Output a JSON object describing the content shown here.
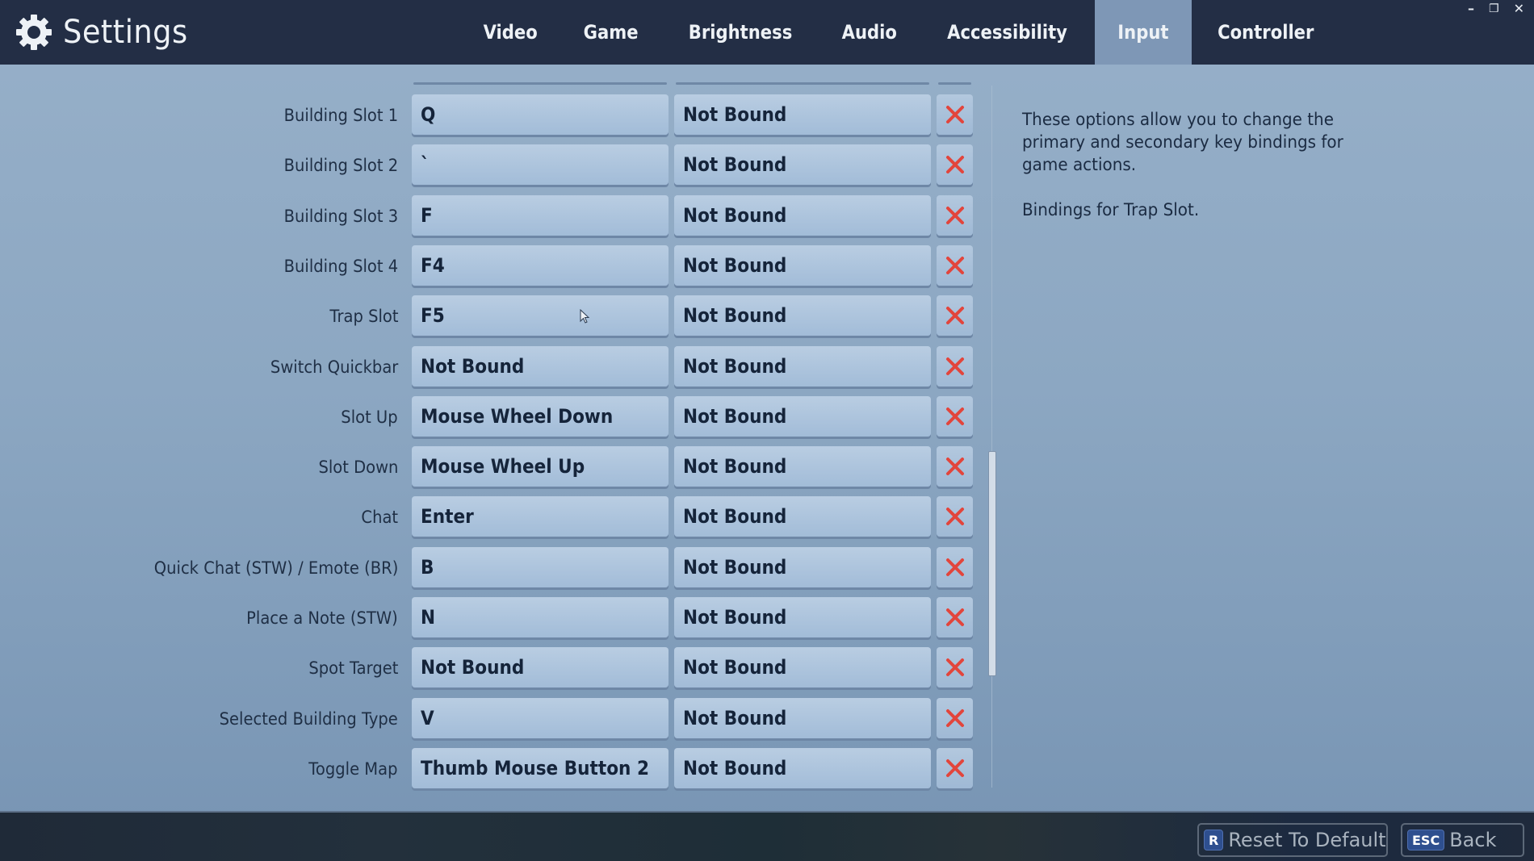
{
  "header": {
    "title": "Settings",
    "icon": "gear-icon",
    "tabs": [
      {
        "label": "Video",
        "active": false
      },
      {
        "label": "Game",
        "active": false
      },
      {
        "label": "Brightness",
        "active": false
      },
      {
        "label": "Audio",
        "active": false
      },
      {
        "label": "Accessibility",
        "active": false
      },
      {
        "label": "Input",
        "active": true
      },
      {
        "label": "Controller",
        "active": false
      }
    ],
    "window_controls": {
      "minimize": "–",
      "restore": "❐",
      "close": "✕"
    }
  },
  "bindings": [
    {
      "action": "Building Slot 1",
      "primary": "Q",
      "secondary": "Not Bound"
    },
    {
      "action": "Building Slot 2",
      "primary": "`",
      "secondary": "Not Bound"
    },
    {
      "action": "Building Slot 3",
      "primary": "F",
      "secondary": "Not Bound"
    },
    {
      "action": "Building Slot 4",
      "primary": "F4",
      "secondary": "Not Bound"
    },
    {
      "action": "Trap Slot",
      "primary": "F5",
      "secondary": "Not Bound"
    },
    {
      "action": "Switch Quickbar",
      "primary": "Not Bound",
      "secondary": "Not Bound"
    },
    {
      "action": "Slot Up",
      "primary": "Mouse Wheel Down",
      "secondary": "Not Bound"
    },
    {
      "action": "Slot Down",
      "primary": "Mouse Wheel Up",
      "secondary": "Not Bound"
    },
    {
      "action": "Chat",
      "primary": "Enter",
      "secondary": "Not Bound"
    },
    {
      "action": "Quick Chat (STW) / Emote (BR)",
      "primary": "B",
      "secondary": "Not Bound"
    },
    {
      "action": "Place a Note (STW)",
      "primary": "N",
      "secondary": "Not Bound"
    },
    {
      "action": "Spot Target",
      "primary": "Not Bound",
      "secondary": "Not Bound"
    },
    {
      "action": "Selected Building Type",
      "primary": "V",
      "secondary": "Not Bound"
    },
    {
      "action": "Toggle Map",
      "primary": "Thumb Mouse Button 2",
      "secondary": "Not Bound"
    }
  ],
  "description": {
    "text": "These options allow you to change the primary and secondary key bindings for game actions.",
    "selected": "Bindings for Trap Slot."
  },
  "footer": {
    "reset": {
      "key": "R",
      "label": "Reset To Default"
    },
    "back": {
      "key": "ESC",
      "label": "Back"
    }
  },
  "colors": {
    "header_bg": "#232e45",
    "active_tab": "#7e97b6",
    "clear_x": "#e2453c",
    "key_badge": "#2e4f8f"
  }
}
